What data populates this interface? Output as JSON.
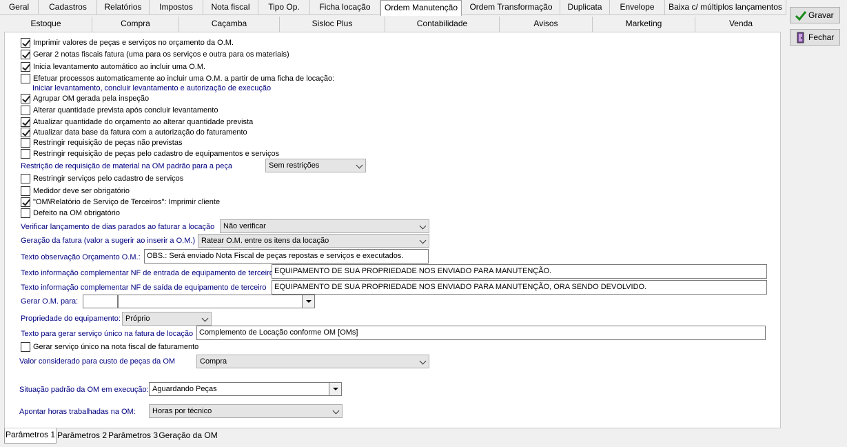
{
  "tabs_row1": [
    {
      "label": "Geral"
    },
    {
      "label": "Cadastros"
    },
    {
      "label": "Relatórios"
    },
    {
      "label": "Impostos"
    },
    {
      "label": "Nota fiscal"
    },
    {
      "label": "Tipo Op."
    },
    {
      "label": "Ficha locação"
    },
    {
      "label": "Ordem Manutenção"
    },
    {
      "label": "Ordem Transformação"
    },
    {
      "label": "Duplicata"
    },
    {
      "label": "Envelope"
    },
    {
      "label": "Baixa c/ múltiplos lançamentos"
    }
  ],
  "tabs_row2": [
    {
      "label": "Estoque"
    },
    {
      "label": "Compra"
    },
    {
      "label": "Caçamba"
    },
    {
      "label": "Sisloc Plus"
    },
    {
      "label": "Contabilidade"
    },
    {
      "label": "Avisos"
    },
    {
      "label": "Marketing"
    },
    {
      "label": "Venda"
    }
  ],
  "buttons": {
    "save": "Gravar",
    "close": "Fechar"
  },
  "checkboxes": [
    {
      "label": "Imprimir valores de peças e serviços no orçamento da O.M.",
      "checked": true
    },
    {
      "label": "Gerar 2 notas fiscais fatura (uma para os serviços e outra para os materiais)",
      "checked": true
    },
    {
      "label": "Inicia levantamento automático ao incluir uma O.M.",
      "checked": true
    },
    {
      "label": "Efetuar processos automaticamente ao incluir uma O.M. a partir de uma ficha de locação:",
      "checked": false
    },
    {
      "label": "Agrupar OM gerada pela inspeção",
      "checked": true
    },
    {
      "label": "Alterar quantidade prevista após concluir levantamento",
      "checked": false
    },
    {
      "label": "Atualizar quantidade do orçamento ao alterar quantidade prevista",
      "checked": true
    },
    {
      "label": "Atualizar data base da fatura com a autorização do faturamento",
      "checked": true
    },
    {
      "label": "Restringir requisição de peças não previstas",
      "checked": false
    },
    {
      "label": "Restringir requisição de peças pelo cadastro de equipamentos e serviços",
      "checked": false
    },
    {
      "label": "Restringir serviços pelo cadastro de serviços",
      "checked": false
    },
    {
      "label": "Medidor deve ser obrigatório",
      "checked": false
    },
    {
      "label": "\"OM\\Relatório de Serviço de Terceiros\": Imprimir cliente",
      "checked": true
    },
    {
      "label": "Defeito na OM obrigatório",
      "checked": false
    },
    {
      "label": "Gerar serviço único na nota fiscal de faturamento",
      "checked": false
    }
  ],
  "sublabel_auto_process": "Iniciar levantamento, concluir levantamento e autorização de execução",
  "fields": {
    "restricao_label": "Restrição de requisição de material na OM padrão para a peça",
    "restricao_value": "Sem restrições",
    "verificar_label": "Verificar lançamento de dias parados ao faturar a locação",
    "verificar_value": "Não verificar",
    "geracao_label": "Geração da fatura (valor a sugerir ao inserir a O.M.)",
    "geracao_value": "Ratear O.M. entre os itens da locação",
    "obs_label": "Texto observação Orçamento O.M.:",
    "obs_value": "OBS.: Será enviado Nota Fiscal de peças repostas e serviços e executados.",
    "nf_entrada_label": "Texto informação complementar NF de entrada de equipamento de terceiro",
    "nf_entrada_value": "EQUIPAMENTO DE SUA PROPRIEDADE NOS ENVIADO PARA MANUTENÇÃO.",
    "nf_saida_label": "Texto informação complementar NF de saída de equipamento de terceiro",
    "nf_saida_value": "EQUIPAMENTO DE SUA PROPRIEDADE NOS ENVIADO PARA MANUTENÇÃO, ORA SENDO DEVOLVIDO.",
    "gerar_om_label": "Gerar O.M. para:",
    "gerar_om_code": "",
    "gerar_om_value": "",
    "propriedade_label": "Propriedade do equipamento:",
    "propriedade_value": "Próprio",
    "servico_unico_label": "Texto para gerar serviço único na fatura de locação",
    "servico_unico_value": "Complemento de Locação conforme OM [OMs]",
    "valor_custo_label": "Valor considerado para custo de peças da OM",
    "valor_custo_value": "Compra",
    "situacao_label": "Situação padrão da OM em execução:",
    "situacao_value": "Aguardando Peças",
    "apontar_label": "Apontar horas trabalhadas na OM:",
    "apontar_value": "Horas por técnico"
  },
  "bottom_tabs": [
    {
      "label": "Parâmetros 1"
    },
    {
      "label": "Parâmetros 2"
    },
    {
      "label": "Parâmetros 3"
    },
    {
      "label": "Geração da OM"
    }
  ]
}
